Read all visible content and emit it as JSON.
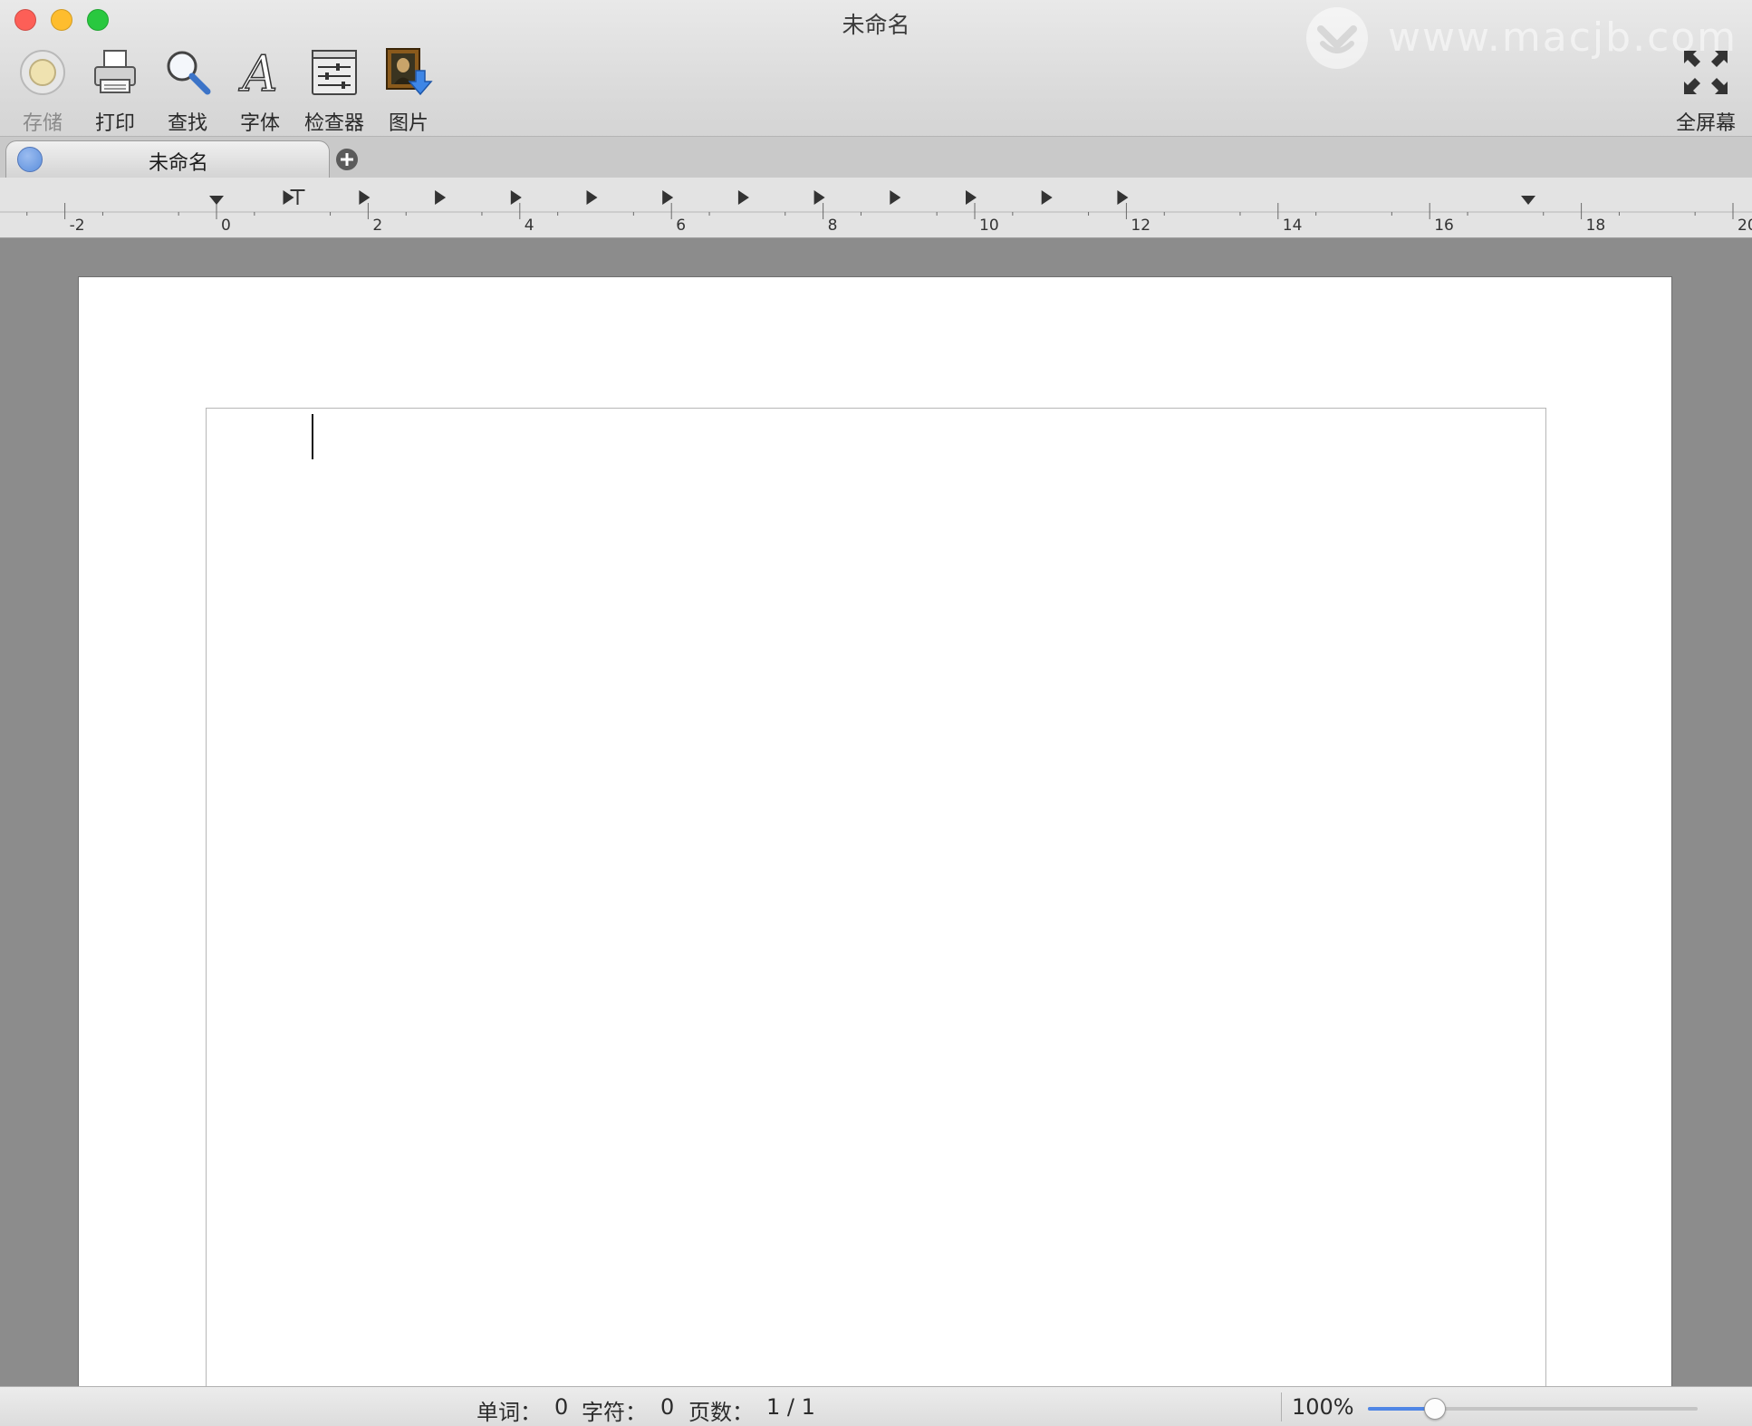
{
  "window": {
    "title": "未命名"
  },
  "watermark": {
    "text": "www.macjb.com"
  },
  "toolbar": {
    "save_label": "存储",
    "print_label": "打印",
    "find_label": "查找",
    "font_label": "字体",
    "inspector_label": "检查器",
    "image_label": "图片",
    "fullscreen_label": "全屏幕"
  },
  "tabs": [
    {
      "label": "未命名",
      "active": true
    }
  ],
  "ruler": {
    "labels": [
      "-2",
      "0",
      "2",
      "4",
      "6",
      "8",
      "10",
      "12",
      "14",
      "16",
      "18",
      "20"
    ]
  },
  "status": {
    "words_label": "单词：",
    "words_value": "0",
    "chars_label": "字符：",
    "chars_value": "0",
    "pages_label": "页数：",
    "pages_value": "1 / 1",
    "zoom_label": "100%",
    "zoom_slider_fraction": 0.2
  },
  "colors": {
    "accent": "#4f86e5",
    "close": "#fd5f57",
    "minimize": "#febd2e",
    "maximize": "#29c83f"
  }
}
